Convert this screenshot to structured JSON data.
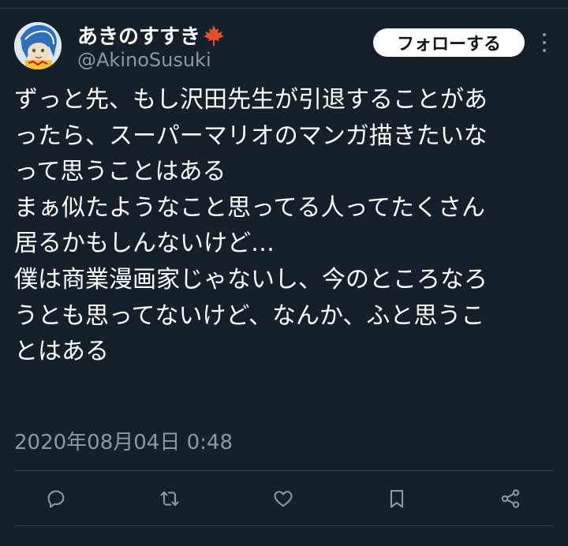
{
  "tweet": {
    "author": {
      "display_name": "あきのすすき",
      "handle": "@AkinoSusuki",
      "badge_icon": "maple-leaf-icon"
    },
    "follow_label": "フォローする",
    "text_lines": [
      "ずっと先、もし沢田先生が引退することがあ",
      "ったら、スーパーマリオのマンガ描きたいな",
      "って思うことはある",
      "まぁ似たようなこと思ってる人ってたくさん",
      "居るかもしんないけど…",
      "僕は商業漫画家じゃないし、今のところなろ",
      "うとも思ってないけど、なんか、ふと思うこ",
      "とはある"
    ],
    "timestamp": "2020年08月04日 0:48",
    "actions": [
      "reply-icon",
      "retweet-icon",
      "like-icon",
      "bookmark-icon",
      "share-icon"
    ]
  },
  "colors": {
    "background": "#15202b",
    "text": "#ffffff",
    "secondary_text": "#8b98a5",
    "divider": "#38444d",
    "maple": "#e0532a"
  }
}
